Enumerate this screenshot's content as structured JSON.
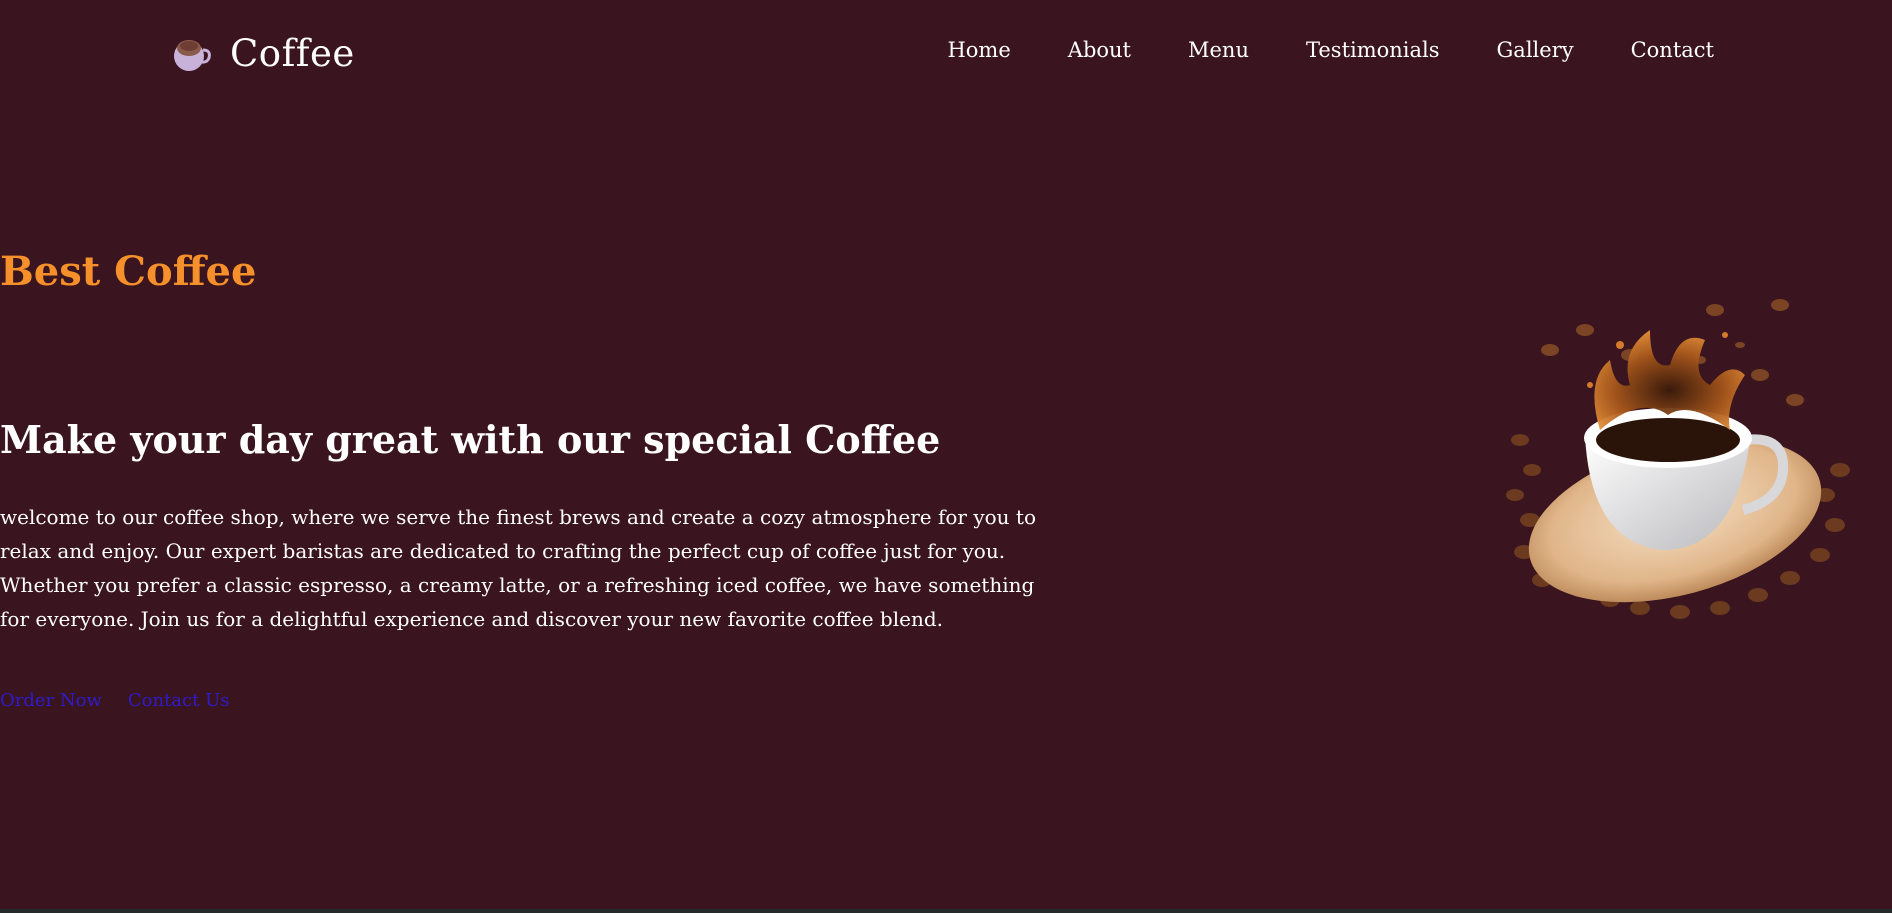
{
  "brand": {
    "name": "Coffee",
    "icon": "coffee-cup-icon"
  },
  "nav": {
    "items": [
      {
        "label": "Home"
      },
      {
        "label": "About"
      },
      {
        "label": "Menu"
      },
      {
        "label": "Testimonials"
      },
      {
        "label": "Gallery"
      },
      {
        "label": "Contact"
      }
    ]
  },
  "hero": {
    "eyebrow": "Best Coffee",
    "headline": "Make your day great with our special Coffee",
    "description": "welcome to our coffee shop, where we serve the finest brews and create a cozy atmosphere for you to relax and enjoy. Our expert baristas are dedicated to crafting the perfect cup of coffee just for you. Whether you prefer a classic espresso, a creamy latte, or a refreshing iced coffee, we have something for everyone. Join us for a delightful experience and discover your new favorite coffee blend.",
    "buttons": {
      "order_label": "Order Now",
      "contact_label": "Contact Us"
    },
    "image": "coffee-cup-splash-with-beans"
  },
  "colors": {
    "background": "#3a141e",
    "accent": "#f5902a",
    "text": "#ffffff",
    "link": "#2f1bcf"
  }
}
